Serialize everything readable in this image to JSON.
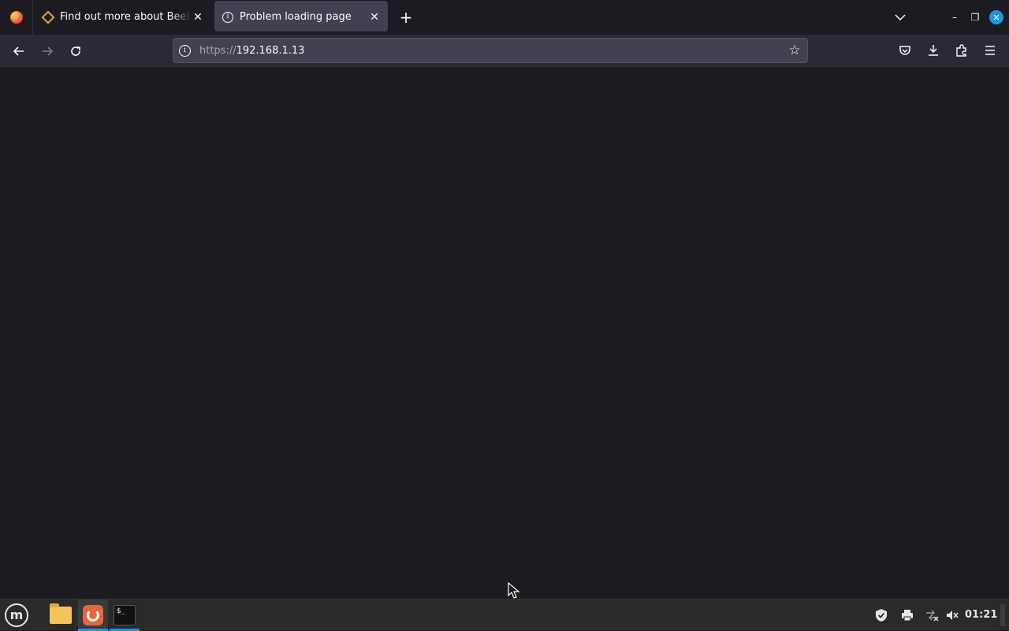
{
  "browser": {
    "tabs": [
      {
        "label": "Find out more about BeeBOX",
        "icon": "beebox-icon",
        "active": false
      },
      {
        "label": "Problem loading page",
        "icon": "info-icon",
        "active": true
      }
    ],
    "new_tab_symbol": "+",
    "tab_close_symbol": "✕",
    "url": {
      "scheme": "https://",
      "host": "192.168.1.13"
    },
    "window_controls": {
      "minimize": "–",
      "maximize": "❐",
      "close": "✕"
    }
  },
  "taskbar": {
    "menu_logo_text": "m",
    "terminal_text": "$_",
    "clock": "01:21"
  },
  "colors": {
    "page_background": "#1c1b22",
    "toolbar": "#2b2a33",
    "urlbar": "#42414d",
    "active_tab": "#42414d",
    "taskbar": "#2a2a2a",
    "accent": "#1f97e0"
  }
}
